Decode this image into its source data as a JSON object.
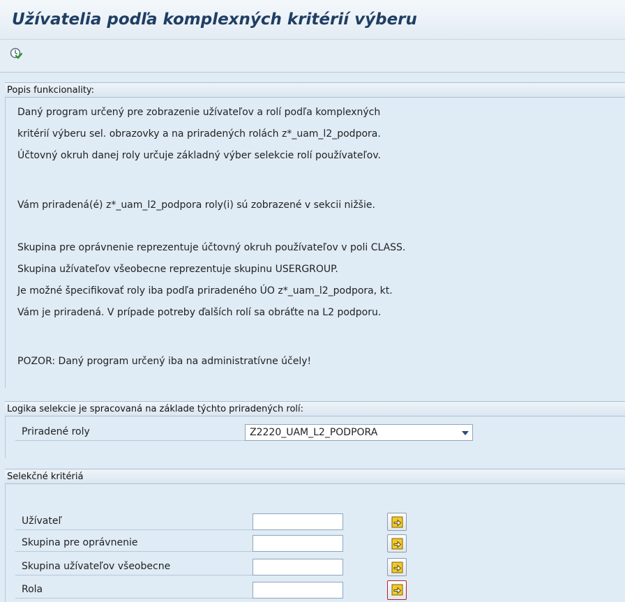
{
  "page": {
    "title": "Užívatelia podľa komplexných kritérií výberu"
  },
  "toolbar": {
    "icons": [
      "execute-icon"
    ]
  },
  "description": {
    "header": "Popis funkcionality:",
    "lines": [
      "Daný program určený pre zobrazenie užívateľov a rolí podľa komplexných",
      "kritérií výberu sel. obrazovky a na priradených rolách z*_uam_l2_podpora.",
      "Účtovný okruh danej roly určuje základný výber selekcie rolí používateľov.",
      "",
      "Vám priradená(é) z*_uam_l2_podpora roly(i) sú zobrazené v sekcii nižšie.",
      "",
      "Skupina pre oprávnenie reprezentuje účtovný okruh používateľov v poli CLASS.",
      "Skupina užívateľov všeobecne reprezentuje skupinu USERGROUP.",
      "Je možné špecifikovať roly iba podľa priradeného ÚO z*_uam_l2_podpora, kt.",
      "Vám je priradená. V prípade potreby ďalších rolí sa obráťte na L2 podporu.",
      "",
      "POZOR: Daný program určený iba na administratívne účely!"
    ]
  },
  "roles_section": {
    "header": "Logika selekcie je spracovaná na základe týchto priradených rolí:",
    "field_label": "Priradené roly",
    "selected_value": "Z2220_UAM_L2_PODPORA"
  },
  "criteria_section": {
    "header": "Selekčné kritériá",
    "fields": [
      {
        "label": "Užívateľ",
        "value": ""
      },
      {
        "label": "Skupina pre oprávnenie",
        "value": ""
      },
      {
        "label": "Skupina užívateľov všeobecne",
        "value": ""
      },
      {
        "label": "Rola",
        "value": ""
      }
    ]
  },
  "colors": {
    "background": "#dfebf5",
    "title_text": "#1f3e63",
    "focus_border": "#b31e2b",
    "multi_select_icon": "#f0c419"
  }
}
